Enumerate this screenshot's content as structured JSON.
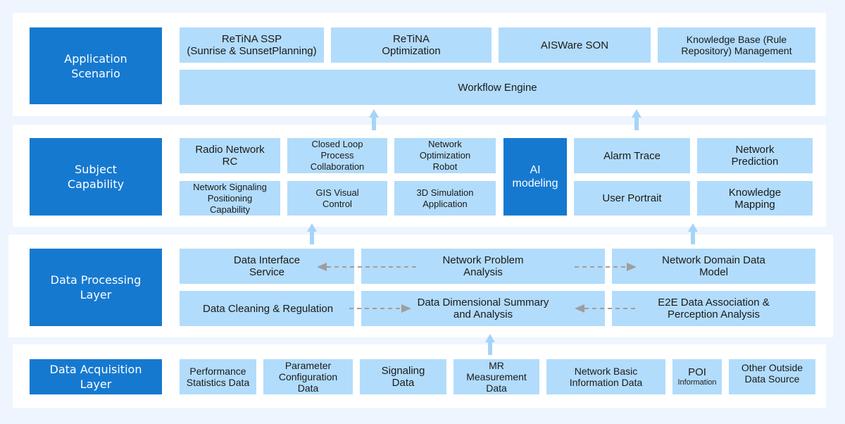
{
  "colors": {
    "background": "#EEF5FE",
    "panel": "#FFFFFF",
    "layer_label": "#1679D0",
    "module": "#B2DCFB",
    "arrow": "#A6D4F8",
    "dashed_arrow": "#9E9E9E"
  },
  "layers": {
    "application": {
      "label": "Application\nScenario",
      "modules": [
        "ReTiNA SSP\n(Sunrise & SunsetPlanning)",
        "ReTiNA\nOptimization",
        "AISWare SON",
        "Knowledge Base (Rule\nRepository) Management"
      ],
      "engine": "Workflow Engine"
    },
    "subject": {
      "label": "Subject\nCapability",
      "modules": [
        "Radio Network\nRC",
        "Closed Loop\nProcess\nCollaboration",
        "Network\nOptimization\nRobot",
        "Network Signaling\nPositioning\nCapability",
        "GIS Visual\nControl",
        "3D Simulation\nApplication",
        "Alarm Trace",
        "Network\nPrediction",
        "User Portrait",
        "Knowledge\nMapping"
      ],
      "ai": "AI\nmodeling"
    },
    "processing": {
      "label": "Data Processing\nLayer",
      "modules": [
        "Data Interface\nService",
        "Network Problem\nAnalysis",
        "Network Domain Data\nModel",
        "Data Cleaning & Regulation",
        "Data Dimensional Summary\nand Analysis",
        "E2E Data Association &\nPerception Analysis"
      ]
    },
    "acquisition": {
      "label": "Data Acquisition\nLayer",
      "modules": [
        "Performance\nStatistics Data",
        "Parameter\nConfiguration\nData",
        "Signaling\nData",
        "MR\nMeasurement\nData",
        "Network Basic\nInformation Data",
        "POI",
        "Other Outside\nData Source"
      ],
      "poi_sub": "Information"
    }
  }
}
